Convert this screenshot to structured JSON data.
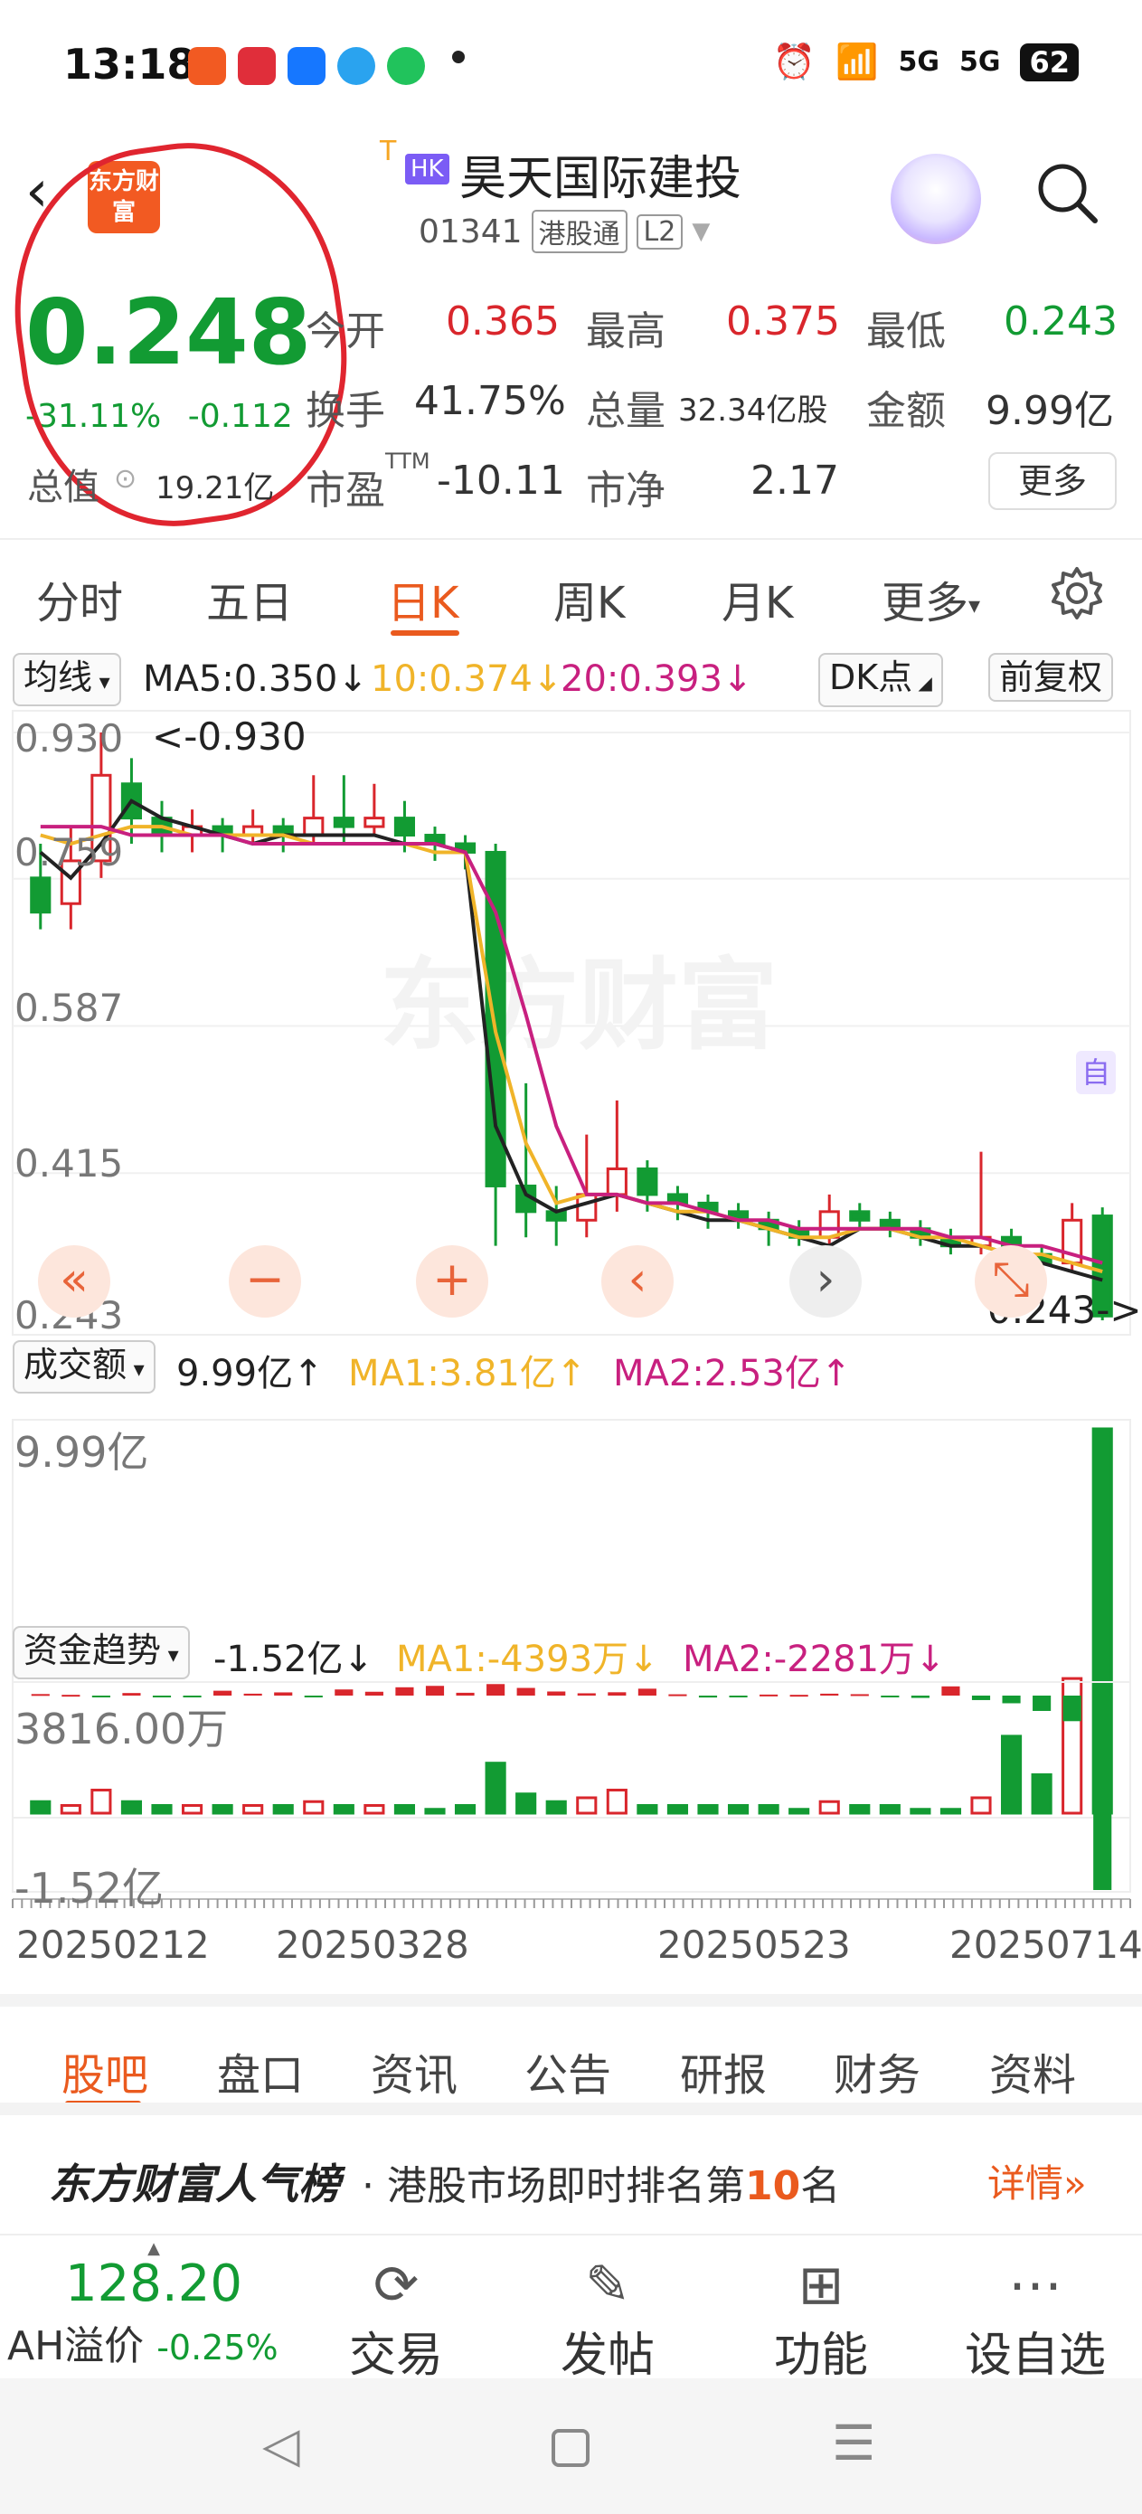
{
  "status_bar": {
    "time": "13:18",
    "battery": "62",
    "network": "5G",
    "app_icon_names": [
      "mail-app-icon",
      "pinduoduo-icon",
      "alipay-icon",
      "telegram-icon",
      "wechat-icon"
    ]
  },
  "header": {
    "logo_text": "东方财富",
    "t_mark": "T",
    "market_badge": "HK",
    "stock_name": "昊天国际建投",
    "stock_code": "01341",
    "tag1": "港股通",
    "tag2": "L2"
  },
  "quote": {
    "price": "0.248",
    "change_pct": "-31.11%",
    "change_amt": "-0.112",
    "open_label": "今开",
    "open": "0.365",
    "high_label": "最高",
    "high": "0.375",
    "low_label": "最低",
    "low": "0.243",
    "turnover_label": "换手",
    "turnover": "41.75%",
    "volume_label": "总量",
    "volume": "32.34亿股",
    "amount_label": "金额",
    "amount": "9.99亿",
    "mktcap_label": "总值",
    "mktcap": "19.21亿",
    "pe_label": "市盈",
    "pe_sup": "TTM",
    "pe": "-10.11",
    "pb_label": "市净",
    "pb": "2.17",
    "more": "更多"
  },
  "period_tabs": [
    "分时",
    "五日",
    "日K",
    "周K",
    "月K",
    "更多"
  ],
  "active_period": 2,
  "chart_controls": {
    "ma_select": "均线",
    "ma5": "MA5:0.350",
    "ma10": "10:0.374",
    "ma20": "20:0.393",
    "dk": "DK点",
    "adjust": "前复权",
    "watermark": "东方财富",
    "self_marker": "自"
  },
  "price_axis": {
    "labels": [
      "0.930",
      "0.759",
      "0.587",
      "0.415",
      "0.243"
    ],
    "max_annotation": "<-0.930",
    "min_annotation": "0.243->"
  },
  "nav_buttons": [
    "«",
    "−",
    "+",
    "‹",
    "›",
    "⤡"
  ],
  "volume_panel": {
    "select": "成交额",
    "value": "9.99亿",
    "ma1": "MA1:3.81亿",
    "ma2": "MA2:2.53亿",
    "axis_label": "9.99亿"
  },
  "flow_panel": {
    "select": "资金趋势",
    "value": "-1.52亿",
    "ma1": "MA1:-4393万",
    "ma2": "MA2:-2281万",
    "axis_top": "3816.00万",
    "axis_bottom": "-1.52亿"
  },
  "date_axis": [
    "20250212",
    "20250328",
    "20250523",
    "20250714"
  ],
  "bottom_tabs": [
    "股吧",
    "盘口",
    "资讯",
    "公告",
    "研报",
    "财务",
    "资料"
  ],
  "rank": {
    "brand": "东方财富人气榜",
    "text_prefix": "· 港股市场即时排名第",
    "rank_num": "10",
    "text_suffix": "名",
    "detail": "详情"
  },
  "toolbar": {
    "ah_value": "128.20",
    "ah_label": "AH溢价",
    "ah_change": "-0.25%",
    "trade": "交易",
    "post": "发帖",
    "func": "功能",
    "watch": "设自选"
  },
  "colors": {
    "up": "#d9262c",
    "down": "#129b33",
    "accent": "#ea5a1e",
    "ma5": "#222222",
    "ma10": "#f0b429",
    "ma20": "#c8207f"
  },
  "chart_data": {
    "type": "candlestick",
    "series": [
      {
        "name": "MA5",
        "values": [
          0.79,
          0.76,
          0.8,
          0.85,
          0.83,
          0.82,
          0.81,
          0.8,
          0.81,
          0.81,
          0.81,
          0.81,
          0.8,
          0.8,
          0.79,
          0.47,
          0.39,
          0.37,
          0.38,
          0.39,
          0.38,
          0.37,
          0.36,
          0.36,
          0.35,
          0.34,
          0.33,
          0.35,
          0.35,
          0.34,
          0.33,
          0.33,
          0.32,
          0.31,
          0.3,
          0.29
        ]
      },
      {
        "name": "10",
        "values": [
          0.81,
          0.8,
          0.81,
          0.82,
          0.82,
          0.81,
          0.81,
          0.81,
          0.81,
          0.8,
          0.8,
          0.8,
          0.8,
          0.79,
          0.79,
          0.58,
          0.45,
          0.38,
          0.39,
          0.39,
          0.38,
          0.37,
          0.37,
          0.36,
          0.35,
          0.34,
          0.34,
          0.35,
          0.35,
          0.34,
          0.34,
          0.33,
          0.32,
          0.32,
          0.31,
          0.3
        ]
      },
      {
        "name": "20",
        "values": [
          0.82,
          0.82,
          0.82,
          0.81,
          0.81,
          0.81,
          0.81,
          0.8,
          0.8,
          0.8,
          0.8,
          0.8,
          0.8,
          0.8,
          0.79,
          0.72,
          0.6,
          0.47,
          0.39,
          0.39,
          0.38,
          0.38,
          0.37,
          0.36,
          0.36,
          0.35,
          0.35,
          0.35,
          0.35,
          0.35,
          0.34,
          0.34,
          0.33,
          0.33,
          0.32,
          0.31
        ]
      }
    ],
    "candles": [
      [
        0.76,
        0.72,
        0.8,
        0.7
      ],
      [
        0.73,
        0.78,
        0.82,
        0.7
      ],
      [
        0.78,
        0.88,
        0.93,
        0.76
      ],
      [
        0.87,
        0.83,
        0.9,
        0.8
      ],
      [
        0.83,
        0.81,
        0.85,
        0.79
      ],
      [
        0.81,
        0.82,
        0.84,
        0.79
      ],
      [
        0.82,
        0.81,
        0.83,
        0.79
      ],
      [
        0.81,
        0.82,
        0.84,
        0.8
      ],
      [
        0.82,
        0.81,
        0.83,
        0.79
      ],
      [
        0.81,
        0.83,
        0.88,
        0.8
      ],
      [
        0.83,
        0.82,
        0.88,
        0.8
      ],
      [
        0.82,
        0.83,
        0.87,
        0.81
      ],
      [
        0.83,
        0.81,
        0.85,
        0.79
      ],
      [
        0.81,
        0.8,
        0.82,
        0.78
      ],
      [
        0.8,
        0.79,
        0.81,
        0.77
      ],
      [
        0.79,
        0.4,
        0.8,
        0.33
      ],
      [
        0.4,
        0.37,
        0.52,
        0.34
      ],
      [
        0.37,
        0.36,
        0.4,
        0.33
      ],
      [
        0.36,
        0.39,
        0.46,
        0.34
      ],
      [
        0.39,
        0.42,
        0.5,
        0.37
      ],
      [
        0.42,
        0.39,
        0.43,
        0.37
      ],
      [
        0.39,
        0.38,
        0.4,
        0.36
      ],
      [
        0.38,
        0.37,
        0.39,
        0.35
      ],
      [
        0.37,
        0.36,
        0.38,
        0.35
      ],
      [
        0.36,
        0.35,
        0.37,
        0.33
      ],
      [
        0.35,
        0.34,
        0.36,
        0.33
      ],
      [
        0.34,
        0.37,
        0.39,
        0.33
      ],
      [
        0.37,
        0.36,
        0.38,
        0.35
      ],
      [
        0.36,
        0.35,
        0.37,
        0.34
      ],
      [
        0.35,
        0.34,
        0.36,
        0.33
      ],
      [
        0.34,
        0.33,
        0.35,
        0.32
      ],
      [
        0.33,
        0.34,
        0.44,
        0.32
      ],
      [
        0.34,
        0.32,
        0.35,
        0.31
      ],
      [
        0.32,
        0.31,
        0.33,
        0.3
      ],
      [
        0.31,
        0.36,
        0.38,
        0.3
      ],
      [
        0.365,
        0.248,
        0.375,
        0.243
      ]
    ],
    "volume": [
      0.3,
      0.2,
      0.6,
      0.3,
      0.2,
      0.2,
      0.2,
      0.2,
      0.2,
      0.3,
      0.2,
      0.2,
      0.2,
      0.1,
      0.2,
      1.3,
      0.5,
      0.3,
      0.4,
      0.6,
      0.2,
      0.2,
      0.2,
      0.2,
      0.2,
      0.1,
      0.3,
      0.2,
      0.2,
      0.1,
      0.1,
      0.4,
      2.0,
      1.0,
      3.5,
      9.99
    ],
    "flow": [
      120,
      60,
      -40,
      200,
      -80,
      -60,
      380,
      150,
      250,
      -90,
      480,
      300,
      650,
      760,
      220,
      900,
      600,
      320,
      180,
      260,
      540,
      100,
      -150,
      -120,
      80,
      60,
      150,
      110,
      -80,
      -180,
      720,
      -350,
      -600,
      -1200,
      -2000,
      -15200
    ],
    "ylim": [
      0.243,
      0.93
    ],
    "x_labels": [
      "20250212",
      "20250328",
      "20250523",
      "20250714"
    ]
  }
}
